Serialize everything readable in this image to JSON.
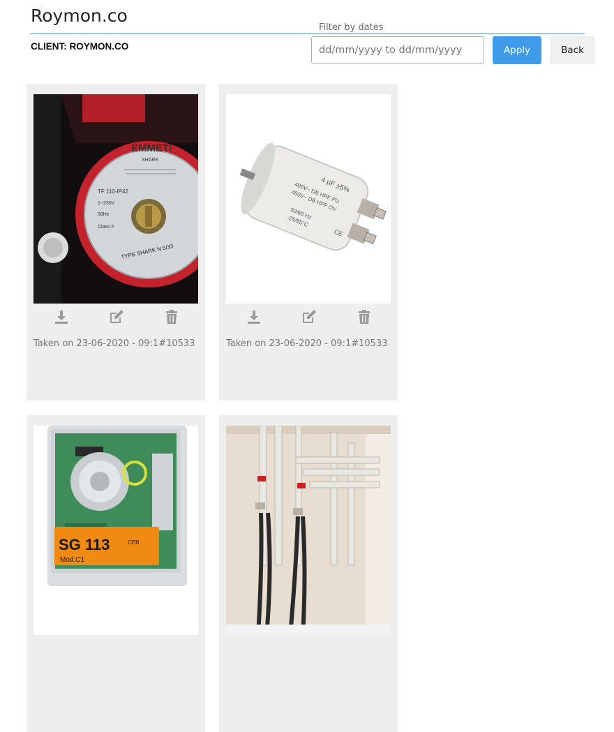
{
  "header": {
    "title": "Roymon.co",
    "client_label": "CLIENT: ROYMON.CO"
  },
  "filter": {
    "label": "Filter by dates",
    "placeholder": "dd/mm/yyyy to dd/mm/yyyy",
    "apply_label": "Apply",
    "back_label": "Back"
  },
  "photos": [
    {
      "caption": "Taken on 23-06-2020 - 09:1#10533",
      "subject": "pump-photo",
      "printed_text": [
        "EMMETI",
        "SHARK",
        "TF 110-IP42",
        "1~230V",
        "50Hz",
        "Class F",
        "TYPE SHARK N 5/33"
      ]
    },
    {
      "caption": "Taken on 23-06-2020 - 09:1#10533",
      "subject": "capacitor-photo",
      "printed_text": [
        "4 µF ±5%",
        "400V~ DB HPF PU",
        "450V~ DB HPF OV",
        "50/60 Hz",
        "-25/85°C",
        "CE"
      ]
    },
    {
      "caption": "",
      "subject": "controller-photo",
      "printed_text": [
        "SG 113",
        "Mod.C1",
        "CEB"
      ]
    },
    {
      "caption": "",
      "subject": "pipes-photo",
      "printed_text": []
    }
  ],
  "icons": {
    "download": "download-icon",
    "edit": "edit-icon",
    "delete": "trash-icon"
  },
  "colors": {
    "apply_bg": "#3d9be9",
    "card_bg": "#eeeeee",
    "icon": "#9a9a9a"
  }
}
